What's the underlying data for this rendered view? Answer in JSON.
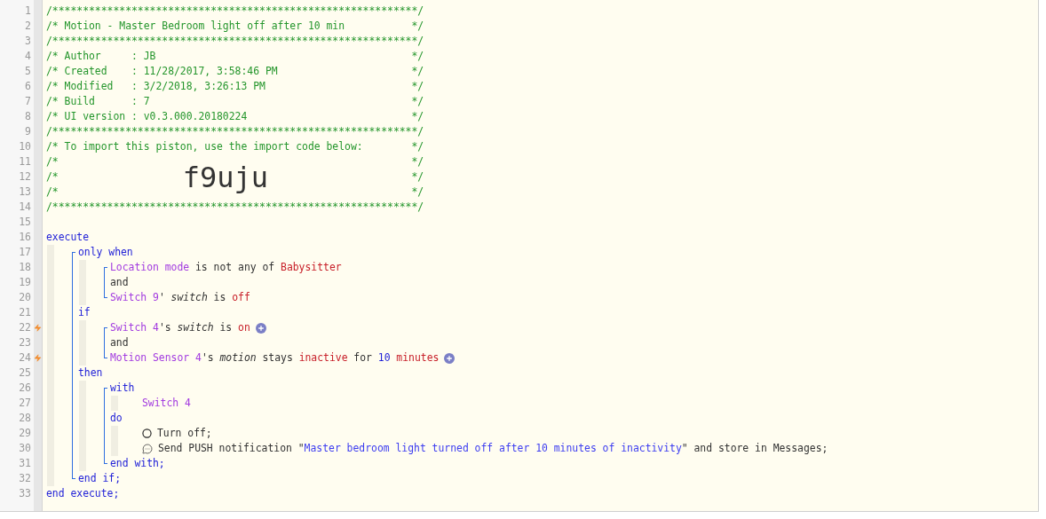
{
  "header": [
    {
      "number": "1",
      "kind": "rule",
      "text": "/************************************************************/"
    },
    {
      "number": "2",
      "kind": "comment",
      "text": "/* Motion - Master Bedroom light off after 10 min",
      "end": "*/"
    },
    {
      "number": "3",
      "kind": "rule",
      "text": "/************************************************************/"
    },
    {
      "number": "4",
      "kind": "comment",
      "text": "/* Author     : JB",
      "end": "*/"
    },
    {
      "number": "5",
      "kind": "comment",
      "text": "/* Created    : 11/28/2017, 3:58:46 PM",
      "end": "*/"
    },
    {
      "number": "6",
      "kind": "comment",
      "text": "/* Modified   : 3/2/2018, 3:26:13 PM",
      "end": "*/"
    },
    {
      "number": "7",
      "kind": "comment",
      "text": "/* Build      : 7",
      "end": "*/"
    },
    {
      "number": "8",
      "kind": "comment",
      "text": "/* UI version : v0.3.000.20180224",
      "end": "*/"
    },
    {
      "number": "9",
      "kind": "rule",
      "text": "/************************************************************/"
    },
    {
      "number": "10",
      "kind": "comment",
      "text": "/* To import this piston, use the import code below:",
      "end": "*/"
    },
    {
      "number": "11",
      "kind": "comment",
      "text": "/*",
      "end": "*/"
    },
    {
      "number": "12",
      "kind": "code",
      "text": "/*",
      "code": "f9uju",
      "end": "*/"
    },
    {
      "number": "13",
      "kind": "comment",
      "text": "/*",
      "end": "*/"
    },
    {
      "number": "14",
      "kind": "rule",
      "text": "/************************************************************/"
    },
    {
      "number": "15",
      "kind": "blank"
    }
  ],
  "program": [
    {
      "number": "16",
      "trigger": false,
      "add": false,
      "segments": [
        {
          "text": "execute",
          "kind": "keyword"
        }
      ]
    },
    {
      "bracket": true,
      "children": [
        {
          "number": "17",
          "trigger": false,
          "add": false,
          "segments": [
            {
              "text": "only when",
              "kind": "keyword"
            }
          ]
        },
        {
          "bracket": true,
          "children": [
            {
              "number": "18",
              "trigger": false,
              "add": false,
              "segments": [
                {
                  "text": "Location mode",
                  "kind": "device"
                },
                {
                  "text": " is not any of ",
                  "kind": "text"
                },
                {
                  "text": "Babysitter",
                  "kind": "value"
                }
              ]
            },
            {
              "number": "19",
              "trigger": false,
              "add": false,
              "segments": [
                {
                  "text": "and",
                  "kind": "text"
                }
              ]
            },
            {
              "number": "20",
              "trigger": false,
              "add": false,
              "segments": [
                {
                  "text": "Switch 9",
                  "kind": "device"
                },
                {
                  "text": "' ",
                  "kind": "text"
                },
                {
                  "text": "switch",
                  "kind": "attribute"
                },
                {
                  "text": " is ",
                  "kind": "text"
                },
                {
                  "text": "off",
                  "kind": "value"
                }
              ]
            }
          ]
        },
        {
          "number": "21",
          "trigger": false,
          "add": false,
          "segments": [
            {
              "text": "if",
              "kind": "keyword"
            }
          ]
        },
        {
          "bracket": true,
          "children": [
            {
              "number": "22",
              "trigger": true,
              "add": true,
              "segments": [
                {
                  "text": "Switch 4",
                  "kind": "device"
                },
                {
                  "text": "'s ",
                  "kind": "text"
                },
                {
                  "text": "switch",
                  "kind": "attribute"
                },
                {
                  "text": " is ",
                  "kind": "text"
                },
                {
                  "text": "on",
                  "kind": "value"
                }
              ]
            },
            {
              "number": "23",
              "trigger": false,
              "add": false,
              "segments": [
                {
                  "text": "and",
                  "kind": "text"
                }
              ]
            },
            {
              "number": "24",
              "trigger": true,
              "add": true,
              "segments": [
                {
                  "text": "Motion Sensor 4",
                  "kind": "device"
                },
                {
                  "text": "'s ",
                  "kind": "text"
                },
                {
                  "text": "motion",
                  "kind": "attribute"
                },
                {
                  "text": " stays ",
                  "kind": "text"
                },
                {
                  "text": "inactive",
                  "kind": "value"
                },
                {
                  "text": " for ",
                  "kind": "text"
                },
                {
                  "text": "10",
                  "kind": "number"
                },
                {
                  "text": " minutes",
                  "kind": "value"
                }
              ]
            }
          ]
        },
        {
          "number": "25",
          "trigger": false,
          "add": false,
          "segments": [
            {
              "text": "then",
              "kind": "keyword"
            }
          ]
        },
        {
          "bracket": true,
          "children": [
            {
              "number": "26",
              "trigger": false,
              "add": false,
              "segments": [
                {
                  "text": "with",
                  "kind": "keyword"
                }
              ]
            },
            {
              "bracket": false,
              "children": [
                {
                  "number": "27",
                  "trigger": false,
                  "add": false,
                  "segments": [
                    {
                      "text": "Switch 4",
                      "kind": "device"
                    }
                  ]
                }
              ]
            },
            {
              "number": "28",
              "trigger": false,
              "add": false,
              "segments": [
                {
                  "text": "do",
                  "kind": "keyword"
                }
              ]
            },
            {
              "bracket": false,
              "children": [
                {
                  "number": "29",
                  "kind": "power",
                  "trigger": false,
                  "add": false,
                  "segments": [
                    {
                      "text": "Turn off;",
                      "kind": "text"
                    }
                  ]
                },
                {
                  "number": "30",
                  "kind": "chat",
                  "trigger": false,
                  "add": false,
                  "segments": [
                    {
                      "text": "Send PUSH notification \"",
                      "kind": "text"
                    },
                    {
                      "text": "Master bedroom light turned off after 10 minutes of inactivity",
                      "kind": "string"
                    },
                    {
                      "text": "\" and store in Messages;",
                      "kind": "text"
                    }
                  ]
                }
              ]
            },
            {
              "number": "31",
              "trigger": false,
              "add": false,
              "segments": [
                {
                  "text": "end with;",
                  "kind": "keyword"
                }
              ]
            }
          ]
        },
        {
          "number": "32",
          "trigger": false,
          "add": false,
          "segments": [
            {
              "text": "end if;",
              "kind": "keyword"
            }
          ]
        }
      ]
    },
    {
      "number": "33",
      "trigger": false,
      "add": false,
      "segments": [
        {
          "text": "end execute;",
          "kind": "keyword"
        }
      ]
    }
  ]
}
